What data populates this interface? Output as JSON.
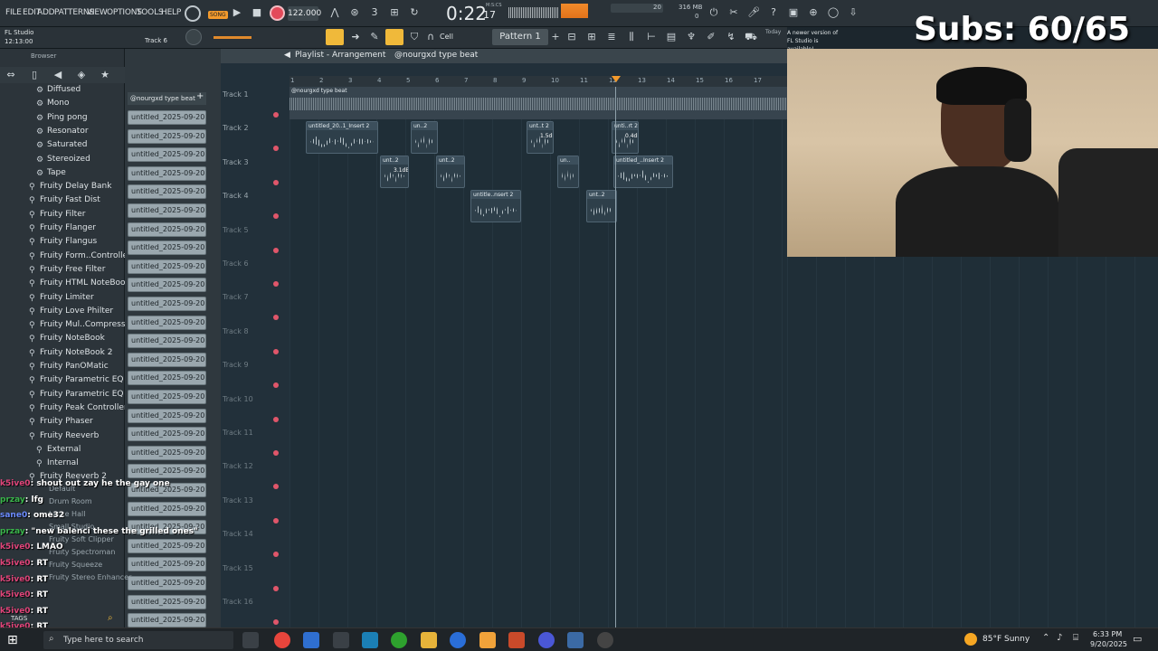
{
  "menu": [
    "FILE",
    "EDIT",
    "ADD",
    "PATTERNS",
    "VIEW",
    "OPTIONS",
    "TOOLS",
    "HELP"
  ],
  "song_badge": "SONG",
  "tempo": "122.000",
  "time": "0:22",
  "time_small": "17",
  "time_mode": "M:S:CS",
  "memory": "316 MB",
  "cpu_value": "20",
  "cpu_zero": "0",
  "hint_title": "FL Studio",
  "hint_time": "12:13:00",
  "hint_track": "Track 6",
  "snap": "Cell",
  "pattern": "Pattern 1",
  "news_today": "Today",
  "news_text": "A newer version of FL Studio is available!",
  "browser_title": "Browser",
  "playlist_title": "Playlist - Arrangement",
  "playlist_pattern": "@nourgxd type beat",
  "channel_header": "@nourgxd type beat",
  "channel_clip_label": "untitled_2025-09-20 18-",
  "browser_items": [
    {
      "label": "Diffused",
      "icon": "gear-icon",
      "indent": 1
    },
    {
      "label": "Mono",
      "icon": "gear-icon",
      "indent": 1
    },
    {
      "label": "Ping pong",
      "icon": "gear-icon",
      "indent": 1
    },
    {
      "label": "Resonator",
      "icon": "gear-icon",
      "indent": 1
    },
    {
      "label": "Saturated",
      "icon": "gear-icon",
      "indent": 1
    },
    {
      "label": "Stereoized",
      "icon": "gear-icon",
      "indent": 1
    },
    {
      "label": "Tape",
      "icon": "gear-icon",
      "indent": 1
    },
    {
      "label": "Fruity Delay Bank",
      "icon": "plugin-icon",
      "indent": 0
    },
    {
      "label": "Fruity Fast Dist",
      "icon": "plugin-icon",
      "indent": 0
    },
    {
      "label": "Fruity Filter",
      "icon": "plugin-icon",
      "indent": 0
    },
    {
      "label": "Fruity Flanger",
      "icon": "plugin-icon",
      "indent": 0
    },
    {
      "label": "Fruity Flangus",
      "icon": "plugin-icon",
      "indent": 0
    },
    {
      "label": "Fruity Form..Controller",
      "icon": "plugin-icon",
      "indent": 0
    },
    {
      "label": "Fruity Free Filter",
      "icon": "plugin-icon",
      "indent": 0
    },
    {
      "label": "Fruity HTML NoteBook",
      "icon": "plugin-icon",
      "indent": 0
    },
    {
      "label": "Fruity Limiter",
      "icon": "plugin-icon",
      "indent": 0
    },
    {
      "label": "Fruity Love Philter",
      "icon": "plugin-icon",
      "indent": 0
    },
    {
      "label": "Fruity Mul..Compressor",
      "icon": "plugin-icon",
      "indent": 0
    },
    {
      "label": "Fruity NoteBook",
      "icon": "plugin-icon",
      "indent": 0
    },
    {
      "label": "Fruity NoteBook 2",
      "icon": "plugin-icon",
      "indent": 0
    },
    {
      "label": "Fruity PanOMatic",
      "icon": "plugin-icon",
      "indent": 0
    },
    {
      "label": "Fruity Parametric EQ",
      "icon": "plugin-icon",
      "indent": 0
    },
    {
      "label": "Fruity Parametric EQ 2",
      "icon": "plugin-icon",
      "indent": 0
    },
    {
      "label": "Fruity Peak Controller",
      "icon": "plugin-icon",
      "indent": 0
    },
    {
      "label": "Fruity Phaser",
      "icon": "plugin-icon",
      "indent": 0
    },
    {
      "label": "Fruity Reeverb",
      "icon": "plugin-icon",
      "indent": 0
    },
    {
      "label": "External",
      "icon": "plugin-icon",
      "indent": 1
    },
    {
      "label": "Internal",
      "icon": "plugin-icon",
      "indent": 1
    },
    {
      "label": "Fruity Reeverb 2",
      "icon": "plugin-icon",
      "indent": 0
    }
  ],
  "tracks": [
    "Track 1",
    "Track 2",
    "Track 3",
    "Track 4",
    "Track 5",
    "Track 6",
    "Track 7",
    "Track 8",
    "Track 9",
    "Track 10",
    "Track 11",
    "Track 12",
    "Track 13",
    "Track 14",
    "Track 15",
    "Track 16"
  ],
  "ruler_marks": [
    "1",
    "2",
    "3",
    "4",
    "5",
    "6",
    "7",
    "8",
    "9",
    "10",
    "11",
    "12",
    "13",
    "14",
    "15",
    "16",
    "17"
  ],
  "track1_clip": "@nourgxd type beat",
  "clips": [
    {
      "label": "untitled_20..1_Insert 2",
      "db": ""
    },
    {
      "label": "un..2",
      "db": ""
    },
    {
      "label": "unt..t 2",
      "db": "1.5dB"
    },
    {
      "label": "unti..rt 2",
      "db": "0.4dB"
    },
    {
      "label": "unt..2",
      "db": "3.1dB"
    },
    {
      "label": "unt..2",
      "db": ""
    },
    {
      "label": "un..",
      "db": ""
    },
    {
      "label": "untitled_..Insert 2",
      "db": ""
    },
    {
      "label": "untitle..nsert 2",
      "db": ""
    },
    {
      "label": "unt..2",
      "db": ""
    }
  ],
  "subs": "Subs: 60/65",
  "chat": [
    {
      "user": "k5ive0",
      "msg": "shout out zay he the gay one",
      "color": "#e0457a"
    },
    {
      "user": "przay",
      "msg": "lfg",
      "color": "#39b54a"
    },
    {
      "user": "sane0",
      "msg": "ome32",
      "color": "#6c8cff"
    },
    {
      "user": "przay",
      "msg": "\"new balenci these the grilled ones\"",
      "color": "#39b54a"
    },
    {
      "user": "k5ive0",
      "msg": "LMAO",
      "color": "#e0457a"
    },
    {
      "user": "k5ive0",
      "msg": "RT",
      "color": "#e0457a"
    },
    {
      "user": "k5ive0",
      "msg": "RT",
      "color": "#e0457a"
    },
    {
      "user": "k5ive0",
      "msg": "RT",
      "color": "#e0457a"
    },
    {
      "user": "k5ive0",
      "msg": "RT",
      "color": "#e0457a"
    },
    {
      "user": "k5ive0",
      "msg": "RT",
      "color": "#e0457a"
    }
  ],
  "chat_overlay_items": [
    "Default",
    "Drum Room",
    "Large Hall",
    "Small Studio",
    "Fruity Soft Clipper",
    "Fruity Spectroman",
    "Fruity Squeeze",
    "Fruity Stereo Enhancer"
  ],
  "tags": "TAGS",
  "search_placeholder": "Type here to search",
  "weather": "85°F  Sunny",
  "clock_time": "6:33 PM",
  "clock_date": "9/20/2025"
}
